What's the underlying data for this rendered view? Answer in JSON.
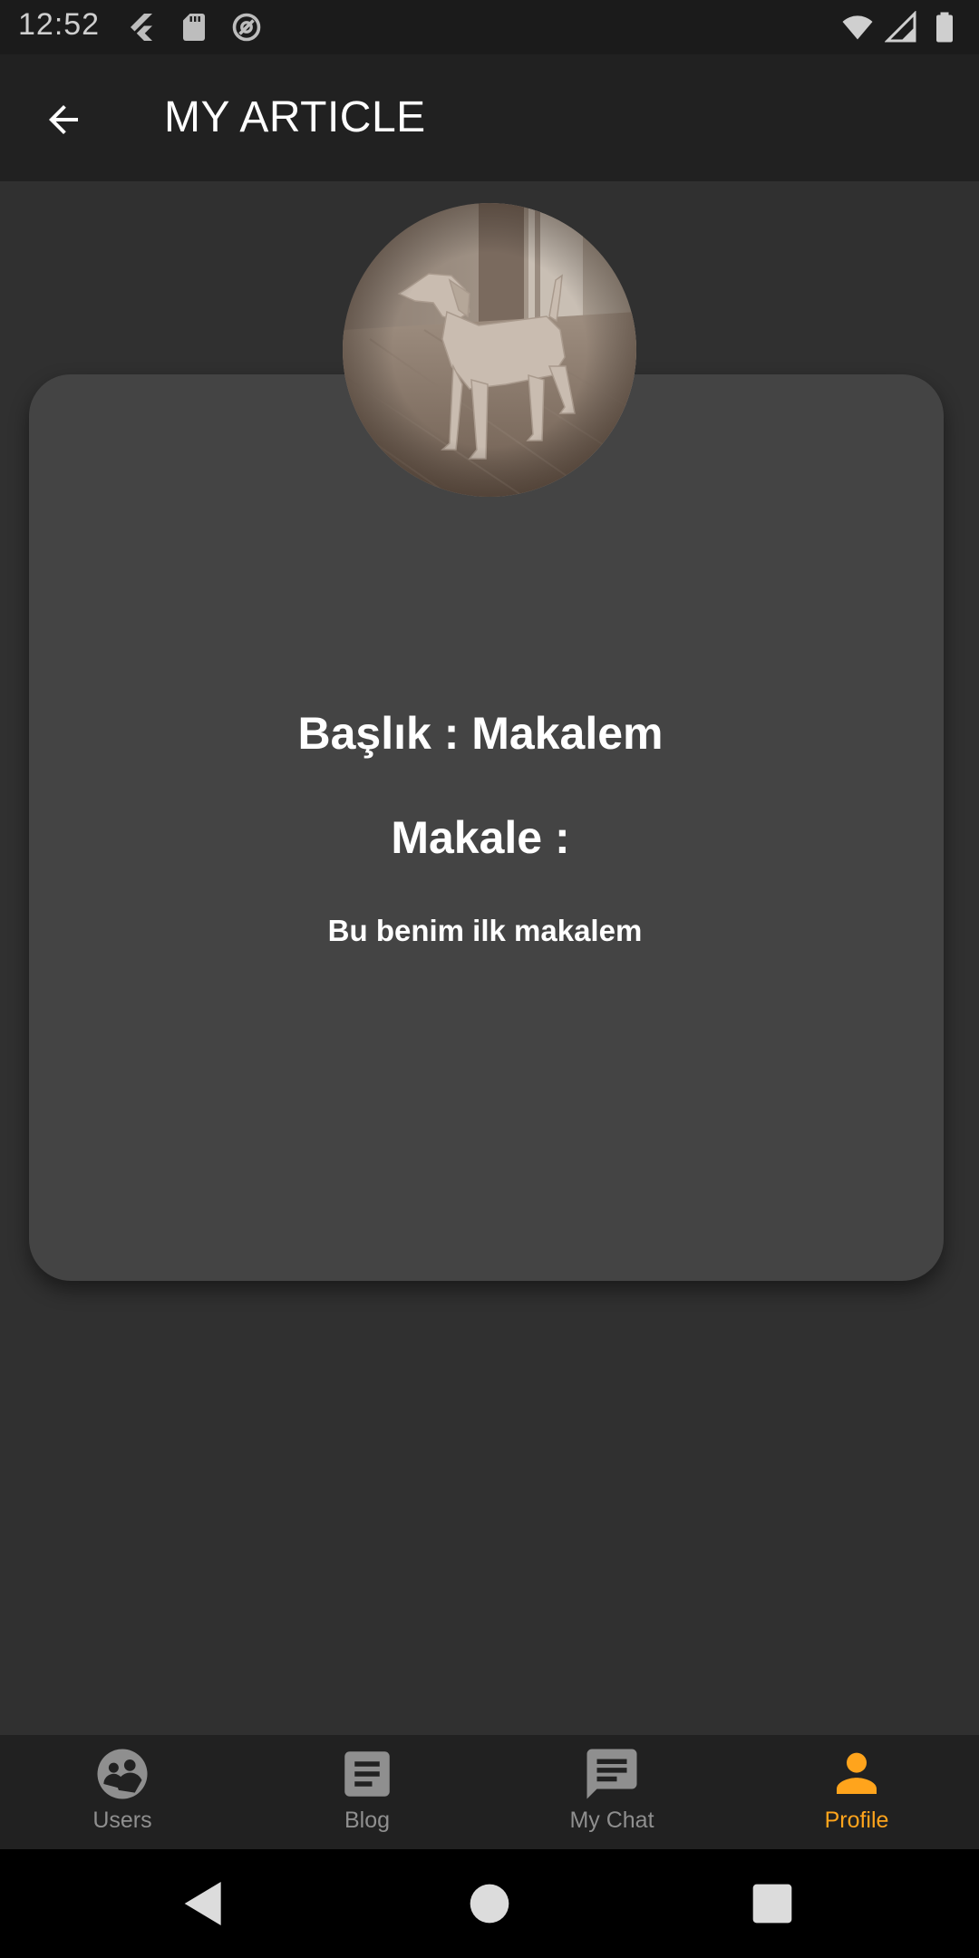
{
  "status_bar": {
    "time": "12:52",
    "left_icons": [
      "flutter-icon",
      "sd-card-icon",
      "at-icon"
    ],
    "right_icons": [
      "wifi-icon",
      "signal-icon",
      "battery-icon"
    ]
  },
  "app_bar": {
    "title": "MY ARTICLE",
    "back_icon": "arrow-back-icon"
  },
  "article": {
    "title_line": "Başlık : Makalem",
    "content_label": "Makale :",
    "content": "Bu benim ilk makalem",
    "image": "dog-photo"
  },
  "bottom_nav": {
    "items": [
      {
        "label": "Users",
        "icon": "users-icon",
        "active": false
      },
      {
        "label": "Blog",
        "icon": "article-icon",
        "active": false
      },
      {
        "label": "My Chat",
        "icon": "chat-icon",
        "active": false
      },
      {
        "label": "Profile",
        "icon": "person-icon",
        "active": true
      }
    ],
    "active_color": "#ffa41c",
    "inactive_color": "#8f8f8f"
  },
  "system_nav": {
    "buttons": [
      "back-triangle-icon",
      "home-circle-icon",
      "recents-square-icon"
    ]
  }
}
